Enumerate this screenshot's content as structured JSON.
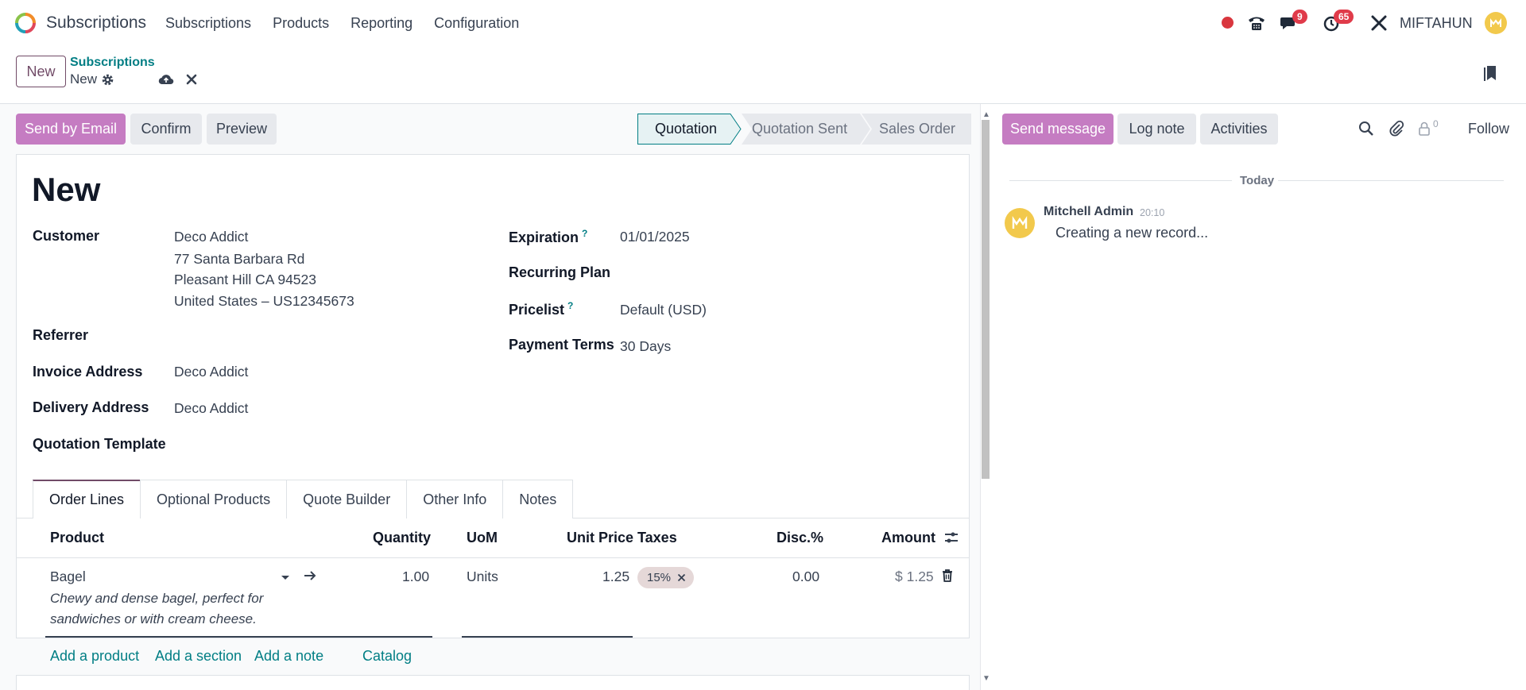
{
  "navbar": {
    "app_name": "Subscriptions",
    "menu": [
      "Subscriptions",
      "Products",
      "Reporting",
      "Configuration"
    ],
    "messages_badge": "9",
    "activities_badge": "65",
    "user_name": "MIFTAHUN"
  },
  "control_panel": {
    "new_label": "New",
    "breadcrumb_parent": "Subscriptions",
    "breadcrumb_current": "New"
  },
  "actions": {
    "send_email": "Send by Email",
    "confirm": "Confirm",
    "preview": "Preview"
  },
  "statusbar": {
    "stages": [
      "Quotation",
      "Quotation Sent",
      "Sales Order"
    ],
    "active": "Quotation"
  },
  "form": {
    "title": "New",
    "customer_label": "Customer",
    "customer_lines": [
      "Deco Addict",
      "77 Santa Barbara Rd",
      "Pleasant Hill CA 94523",
      "United States – US12345673"
    ],
    "referrer_label": "Referrer",
    "invoice_address_label": "Invoice Address",
    "invoice_address": "Deco Addict",
    "delivery_address_label": "Delivery Address",
    "delivery_address": "Deco Addict",
    "quotation_template_label": "Quotation Template",
    "expiration_label": "Expiration",
    "expiration": "01/01/2025",
    "recurring_plan_label": "Recurring Plan",
    "pricelist_label": "Pricelist",
    "pricelist": "Default (USD)",
    "payment_terms_label": "Payment Terms",
    "payment_terms": "30 Days",
    "help_mark": "?"
  },
  "tabs": [
    "Order Lines",
    "Optional Products",
    "Quote Builder",
    "Other Info",
    "Notes"
  ],
  "order_lines": {
    "headers": {
      "product": "Product",
      "quantity": "Quantity",
      "uom": "UoM",
      "unit_price": "Unit Price",
      "taxes": "Taxes",
      "discount": "Disc.%",
      "amount": "Amount"
    },
    "rows": [
      {
        "product": "Bagel",
        "description": "Chewy and dense bagel, perfect for sandwiches or with cream cheese.",
        "quantity": "1.00",
        "uom": "Units",
        "unit_price": "1.25",
        "tax": "15%",
        "discount": "0.00",
        "amount": "$ 1.25"
      }
    ],
    "add_product": "Add a product",
    "add_section": "Add a section",
    "add_note": "Add a note",
    "catalog": "Catalog"
  },
  "chatter": {
    "send_message": "Send message",
    "log_note": "Log note",
    "activities": "Activities",
    "followers_count": "0",
    "follow": "Follow",
    "date_separator": "Today",
    "messages": [
      {
        "author": "Mitchell Admin",
        "time": "20:10",
        "body": "Creating a new record..."
      }
    ]
  },
  "colors": {
    "primary": "#714b67",
    "primary_button": "#c57cc2",
    "link": "#017e84",
    "badge": "#e03b4a"
  }
}
